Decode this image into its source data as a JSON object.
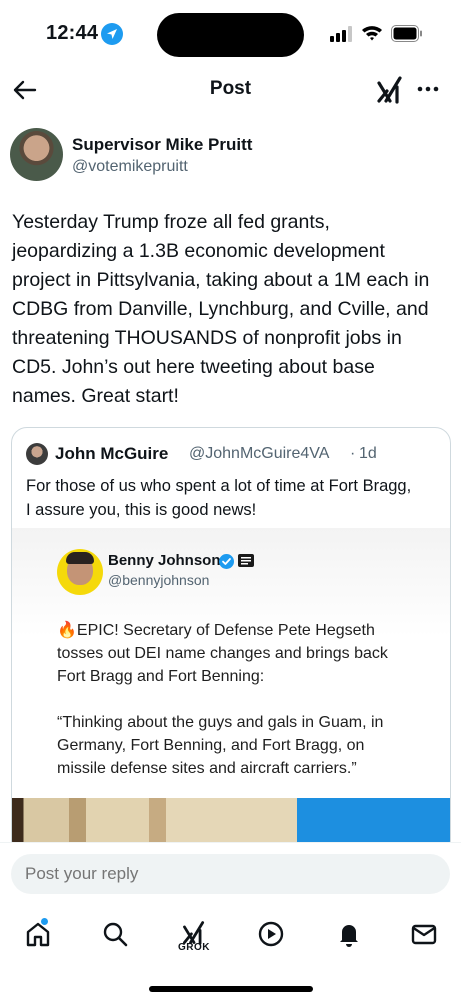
{
  "status_bar": {
    "time": "12:44"
  },
  "header": {
    "title": "Post"
  },
  "post": {
    "author_name": "Supervisor Mike Pruitt",
    "author_handle": "@votemikepruitt",
    "text_lines": [
      "Yesterday Trump froze all fed grants,",
      "jeopardizing a 1.3B economic development",
      "project in Pittsylvania, taking about a 1M each in",
      "CDBG from Danville, Lynchburg, and Cville, and",
      "threatening THOUSANDS of nonprofit jobs in",
      "CD5. John’s out here tweeting about base",
      "names. Great start!"
    ]
  },
  "quote": {
    "author_name": "John McGuire",
    "author_handle": "@JohnMcGuire4VA",
    "separator": "·",
    "time": "1d",
    "text_lines": [
      "For those of us who spent a lot of time at Fort Bragg,",
      "I assure you, this is good news!"
    ],
    "embedded": {
      "name": "Benny Johnson",
      "handle": "@bennyjohnson",
      "line1": "🔥EPIC! Secretary of Defense Pete Hegseth",
      "line2": "tosses out DEI name changes and brings back",
      "line3": "Fort Bragg and Fort Benning:",
      "quote1": "“Thinking about the guys and gals in Guam, in",
      "quote2": "Germany, Fort Benning, and Fort Bragg, on",
      "quote3": "missile defense sites and aircraft carriers.”"
    }
  },
  "reply": {
    "placeholder": "Post your reply"
  },
  "tabbar": {
    "grok_label": "GROK"
  },
  "colors": {
    "accent": "#1d9bf0",
    "text": "#0f1419",
    "secondary": "#536471"
  }
}
